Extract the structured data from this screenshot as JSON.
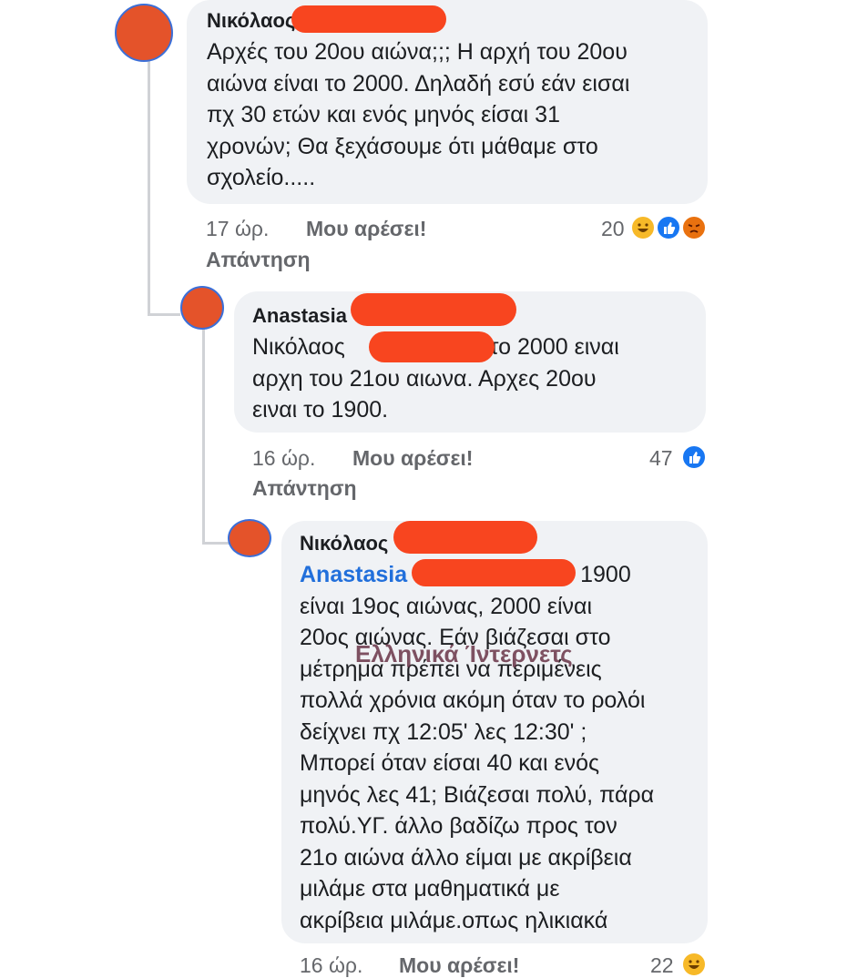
{
  "comments": [
    {
      "author": "Νικόλαος",
      "text": "Αρχές του 20ου αιώνα;;;  Η αρχή του 20ου\nαιώνα είναι το 2000. Δηλαδή εσύ εάν εισαι\nπχ 30 ετών και ενός μηνός είσαι 31\nχρονών;  Θα ξεχάσουμε ότι μάθαμε στο\nσχολείο.....",
      "time": "17 ώρ.",
      "like_label": "Μου αρέσει!",
      "reply_label": "Απάντηση",
      "reaction_count": "20",
      "reactions": [
        "haha-icon",
        "like-icon",
        "angry-icon"
      ]
    },
    {
      "author": "Anastasia",
      "text_prefix": "Νικόλαος",
      "text_suffix": ", το 2000 ειναι\nαρχη του 21ου αιωνα. Αρχες 20ου\nειναι το 1900.",
      "time": "16 ώρ.",
      "like_label": "Μου αρέσει!",
      "reply_label": "Απάντηση",
      "reaction_count": "47",
      "reactions": [
        "like-icon"
      ]
    },
    {
      "author": "Νικόλαος",
      "mention": "Anastasia",
      "mention_suffix": "1900",
      "text": "είναι 19ος αιώνας, 2000 είναι\n20ος αιώνας. Εάν βιάζεσαι στο\nμέτρημα πρέπει να περιμένεις\nπολλά χρόνια ακόμη όταν το ρολόι\nδείχνει πχ 12:05' λες 12:30' ;\nΜπορεί όταν είσαι 40 και ενός\nμηνός λες 41; Βιάζεσαι πολύ, πάρα\nπολύ.ΥΓ. άλλο βαδίζω προς τον\n21ο αιώνα άλλο είμαι με ακρίβεια\nμιλάμε στα μαθηματικά με\nακρίβεια μιλάμε.οπως ηλικιακά",
      "time": "16 ώρ.",
      "like_label": "Μου αρέσει!",
      "reaction_count": "22",
      "reactions": [
        "haha-icon"
      ]
    }
  ],
  "watermark": "Ελληνικά Ίντερνετς",
  "colors": {
    "bubble": "#f0f2f5",
    "redaction": "#f8451f",
    "mention": "#216fdb",
    "meta": "#65676b"
  }
}
